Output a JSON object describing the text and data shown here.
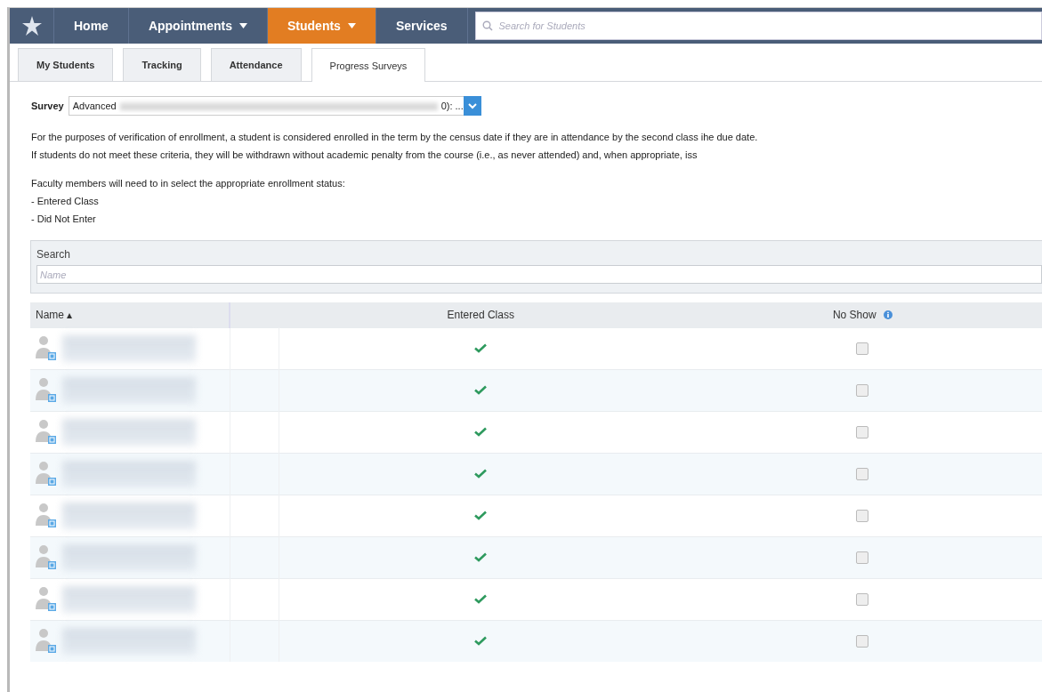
{
  "nav": {
    "items": [
      {
        "label": "Home",
        "selected": false,
        "dropdown": false
      },
      {
        "label": "Appointments",
        "selected": false,
        "dropdown": true
      },
      {
        "label": "Students",
        "selected": true,
        "dropdown": true
      },
      {
        "label": "Services",
        "selected": false,
        "dropdown": false
      }
    ],
    "search": {
      "placeholder": "Search for Students"
    }
  },
  "tabs": [
    {
      "label": "My Students",
      "selected": false
    },
    {
      "label": "Tracking",
      "selected": false
    },
    {
      "label": "Attendance",
      "selected": false
    },
    {
      "label": "Progress Surveys",
      "selected": true
    }
  ],
  "survey": {
    "label": "Survey",
    "value_start": "Advanced",
    "value_end": "0): ..."
  },
  "instructions": [
    "For the purposes of verification of enrollment, a student is considered enrolled in the term by the census date if they are in attendance by the second class ihe due date.",
    "If students do not meet these criteria, they will be withdrawn without academic penalty from the course (i.e., as never attended) and, when appropriate, iss",
    "Faculty members will need to in select the appropriate enrollment status:",
    "- Entered Class",
    "- Did Not Enter"
  ],
  "search_panel": {
    "title": "Search",
    "placeholder": "Name"
  },
  "table": {
    "columns": [
      "Name ▴",
      "Entered Class",
      "No Show"
    ],
    "rows": [
      {
        "entered_class": true,
        "no_show": false
      },
      {
        "entered_class": true,
        "no_show": false
      },
      {
        "entered_class": true,
        "no_show": false
      },
      {
        "entered_class": true,
        "no_show": false
      },
      {
        "entered_class": true,
        "no_show": false
      },
      {
        "entered_class": true,
        "no_show": false
      },
      {
        "entered_class": true,
        "no_show": false
      },
      {
        "entered_class": true,
        "no_show": false
      }
    ]
  }
}
